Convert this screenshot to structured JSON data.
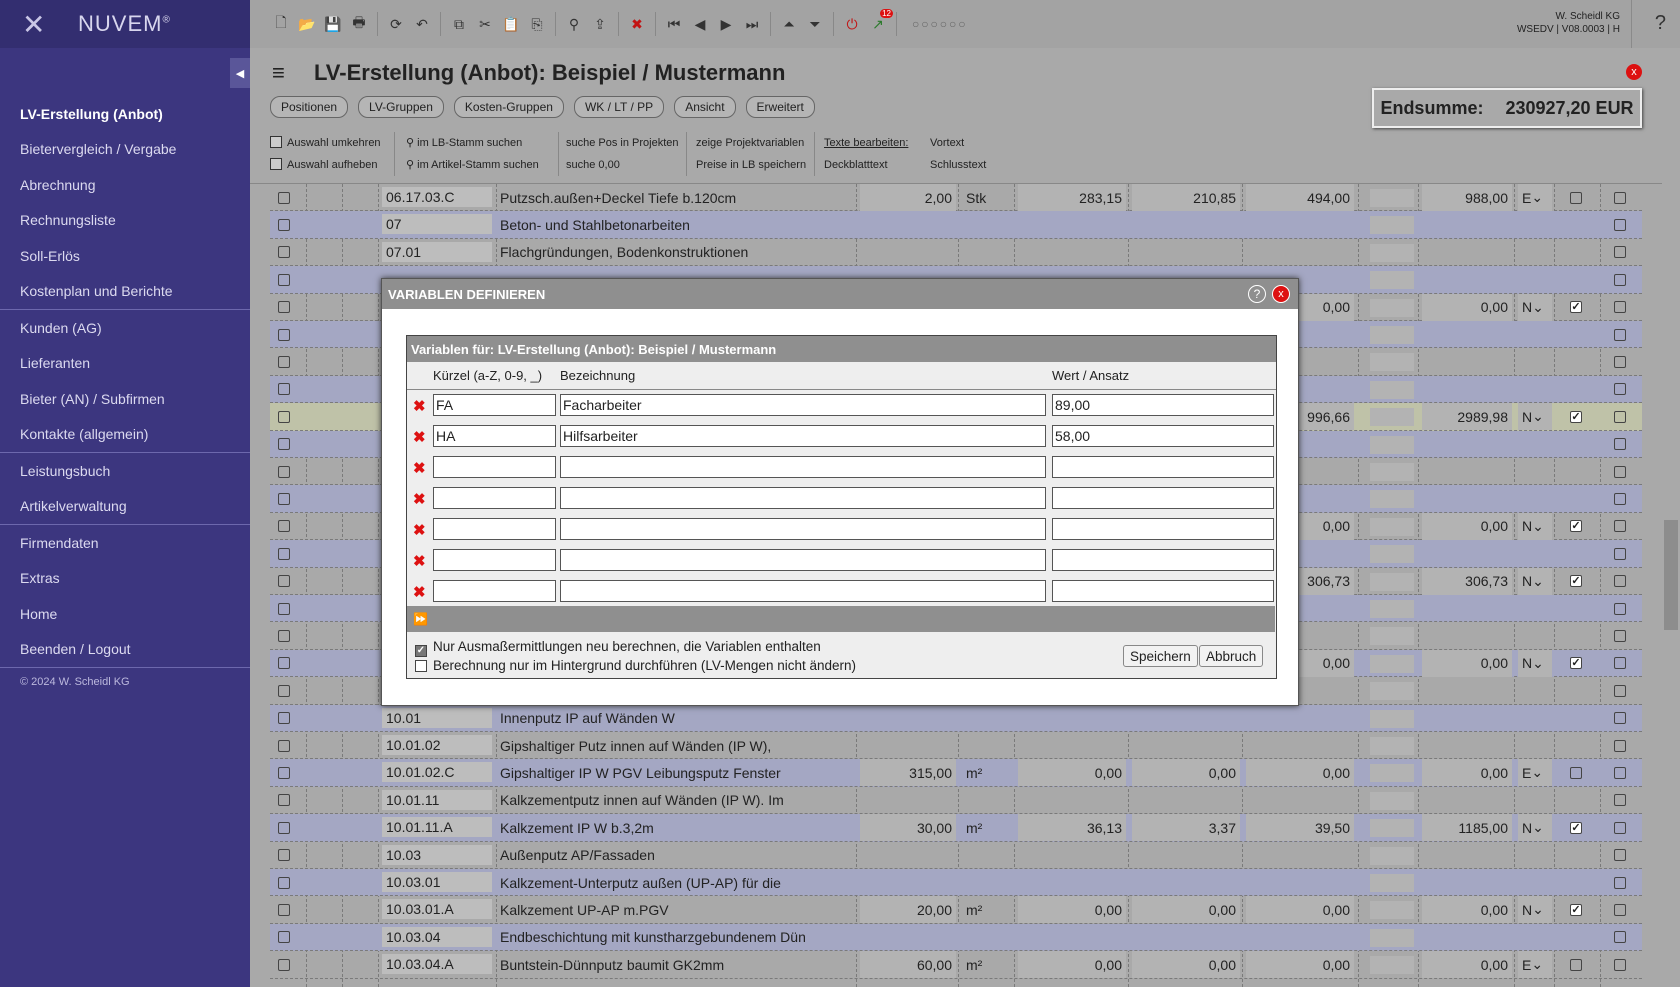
{
  "brand": {
    "name": "NUVEM",
    "reg": "®"
  },
  "sidebar": {
    "groups": [
      [
        {
          "label": "LV-Erstellung (Anbot)",
          "active": true
        },
        {
          "label": "Bietervergleich / Vergabe"
        },
        {
          "label": "Abrechnung"
        },
        {
          "label": "Rechnungsliste"
        },
        {
          "label": "Soll-Erlös"
        },
        {
          "label": "Kostenplan und Berichte"
        }
      ],
      [
        {
          "label": "Kunden (AG)"
        },
        {
          "label": "Lieferanten"
        },
        {
          "label": "Bieter (AN) / Subfirmen"
        },
        {
          "label": "Kontakte (allgemein)"
        }
      ],
      [
        {
          "label": "Leistungsbuch"
        },
        {
          "label": "Artikelverwaltung"
        }
      ],
      [
        {
          "label": "Firmendaten"
        },
        {
          "label": "Extras"
        },
        {
          "label": "Home"
        },
        {
          "label": "Beenden / Logout"
        }
      ]
    ],
    "copyright": "© 2024 W. Scheidl KG"
  },
  "toolbar": {
    "company": "W. Scheidl KG",
    "version": "WSEDV | V08.0003 | H",
    "help": "?",
    "dots": "○○○○○○",
    "badge": "12"
  },
  "header": {
    "title": "LV-Erstellung (Anbot): Beispiel / Mustermann"
  },
  "endsumme": {
    "label": "Endsumme:",
    "value": "230927,20 EUR"
  },
  "tabs": [
    "Positionen",
    "LV-Gruppen",
    "Kosten-Gruppen",
    "WK / LT / PP",
    "Ansicht",
    "Erweitert"
  ],
  "actions": {
    "auswahl_umkehren": "Auswahl umkehren",
    "auswahl_aufheben": "Auswahl aufheben",
    "lb_stamm": "im LB-Stamm suchen",
    "artikel_stamm": "im Artikel-Stamm suchen",
    "suche_pos": "suche Pos in Projekten",
    "suche_null": "suche 0,00",
    "zeige_var": "zeige Projektvariablen",
    "preise_lb": "Preise in LB speichern",
    "texte_bearbeiten": "Texte bearbeiten:",
    "vortext": "Vortext",
    "deckblatttext": "Deckblatttext",
    "schlusstext": "Schlusstext"
  },
  "table": {
    "rows": [
      {
        "pos": "06.17.03.C",
        "text": "Putzsch.außen+Deckel Tiefe b.120cm",
        "menge": "2,00",
        "einheit": "Stk",
        "c1": "283,15",
        "c2": "210,85",
        "c3": "494,00",
        "gp": "988,00",
        "typ": "E",
        "chk": false
      },
      {
        "pos": "07",
        "text": "Beton- und Stahlbetonarbeiten",
        "alt": true
      },
      {
        "pos": "07.01",
        "text": "Flachgründungen, Bodenkonstruktionen"
      },
      {
        "pos": "",
        "text": "",
        "alt": true
      },
      {
        "pos": "",
        "text": "",
        "c3": "0,00",
        "gp": "0,00",
        "typ": "N",
        "chk": true
      },
      {
        "pos": "",
        "text": "",
        "alt": true
      },
      {
        "pos": "",
        "text": ""
      },
      {
        "pos": "",
        "text": "",
        "alt": true
      },
      {
        "pos": "",
        "text": "",
        "c3": "996,66",
        "gp": "2989,98",
        "typ": "N",
        "chk": true,
        "hl": true
      },
      {
        "pos": "",
        "text": "",
        "alt": true
      },
      {
        "pos": "",
        "text": ""
      },
      {
        "pos": "",
        "text": "",
        "alt": true
      },
      {
        "pos": "",
        "text": "",
        "c3": "0,00",
        "gp": "0,00",
        "typ": "N",
        "chk": true
      },
      {
        "pos": "",
        "text": "",
        "alt": true
      },
      {
        "pos": "",
        "text": "",
        "c3": "306,73",
        "gp": "306,73",
        "typ": "N",
        "chk": true
      },
      {
        "pos": "",
        "text": "",
        "alt": true
      },
      {
        "pos": "",
        "text": ""
      },
      {
        "pos": "",
        "text": "",
        "c3": "0,00",
        "gp": "0,00",
        "typ": "N",
        "chk": true,
        "alt": true
      },
      {
        "pos": "",
        "text": ""
      },
      {
        "pos": "10.01",
        "text": "Innenputz IP auf Wänden W",
        "alt": true
      },
      {
        "pos": "10.01.02",
        "text": "Gipshaltiger Putz innen auf Wänden (IP W),"
      },
      {
        "pos": "10.01.02.C",
        "text": "Gipshaltiger IP W PGV Leibungsputz Fenster",
        "menge": "315,00",
        "einheit": "m²",
        "c1": "0,00",
        "c2": "0,00",
        "c3": "0,00",
        "gp": "0,00",
        "typ": "E",
        "chk": false,
        "alt": true
      },
      {
        "pos": "10.01.11",
        "text": "Kalkzementputz innen auf Wänden (IP W). Im"
      },
      {
        "pos": "10.01.11.A",
        "text": "Kalkzement IP W b.3,2m",
        "menge": "30,00",
        "einheit": "m²",
        "c1": "36,13",
        "c2": "3,37",
        "c3": "39,50",
        "gp": "1185,00",
        "typ": "N",
        "chk": true,
        "alt": true
      },
      {
        "pos": "10.03",
        "text": "Außenputz AP/Fassaden"
      },
      {
        "pos": "10.03.01",
        "text": "Kalkzement-Unterputz außen (UP-AP) für die",
        "alt": true
      },
      {
        "pos": "10.03.01.A",
        "text": "Kalkzement UP-AP m.PGV",
        "menge": "20,00",
        "einheit": "m²",
        "c1": "0,00",
        "c2": "0,00",
        "c3": "0,00",
        "gp": "0,00",
        "typ": "N",
        "chk": true
      },
      {
        "pos": "10.03.04",
        "text": "Endbeschichtung mit kunstharzgebundenem Dün",
        "alt": true
      },
      {
        "pos": "10.03.04.A",
        "text": "Buntstein-Dünnputz baumit GK2mm",
        "menge": "60,00",
        "einheit": "m²",
        "c1": "0,00",
        "c2": "0,00",
        "c3": "0,00",
        "gp": "0,00",
        "typ": "E",
        "chk": false
      }
    ]
  },
  "dialog": {
    "title": "VARIABLEN DEFINIEREN",
    "subtitle": "Variablen für: LV-Erstellung (Anbot): Beispiel / Mustermann",
    "col_kuerzel": "Kürzel (a-Z, 0-9, _)",
    "col_bezeichnung": "Bezeichnung",
    "col_wert": "Wert / Ansatz",
    "variables": [
      {
        "kuerzel": "FA",
        "bezeichnung": "Facharbeiter",
        "wert": "89,00"
      },
      {
        "kuerzel": "HA",
        "bezeichnung": "Hilfsarbeiter",
        "wert": "58,00"
      },
      {
        "kuerzel": "",
        "bezeichnung": "",
        "wert": ""
      },
      {
        "kuerzel": "",
        "bezeichnung": "",
        "wert": ""
      },
      {
        "kuerzel": "",
        "bezeichnung": "",
        "wert": ""
      },
      {
        "kuerzel": "",
        "bezeichnung": "",
        "wert": ""
      },
      {
        "kuerzel": "",
        "bezeichnung": "",
        "wert": ""
      }
    ],
    "opt1": "Nur Ausmaßermittlungen neu berechnen, die Variablen enthalten",
    "opt1_checked": true,
    "opt2": "Berechnung nur im Hintergrund durchführen (LV-Mengen nicht ändern)",
    "opt2_checked": false,
    "save": "Speichern",
    "cancel": "Abbruch"
  }
}
